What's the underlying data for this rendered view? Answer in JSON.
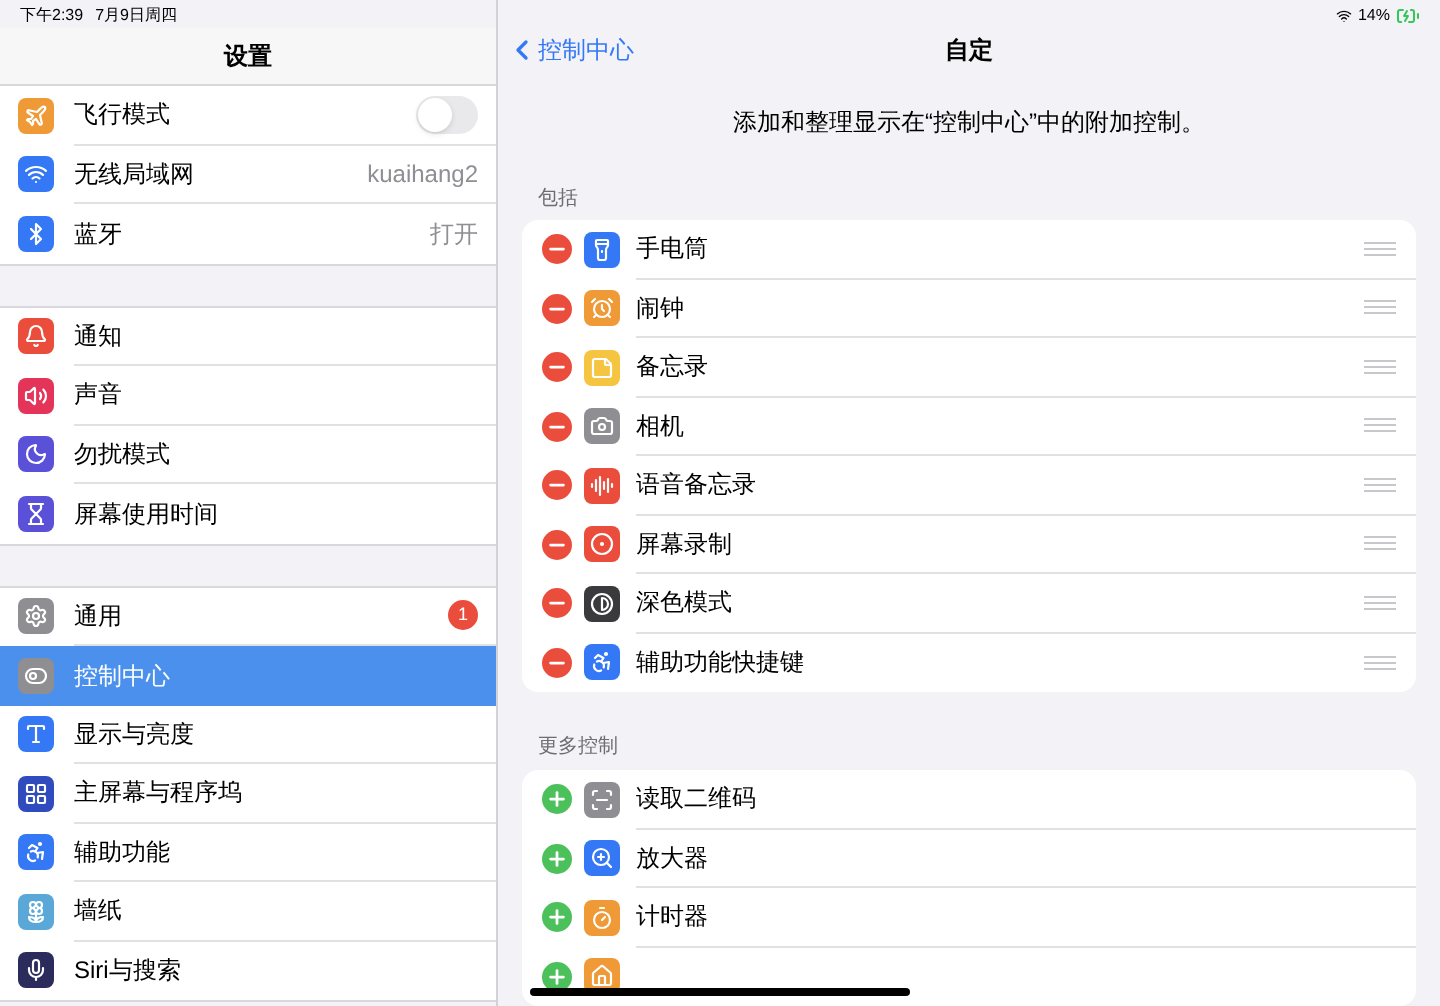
{
  "status_bar": {
    "time": "下午2:39",
    "date": "7月9日周四",
    "battery": "14%"
  },
  "sidebar": {
    "title": "设置",
    "groups": [
      [
        {
          "label": "飞行模式",
          "kind": "toggle",
          "on": false,
          "color": "#f09a37",
          "selected": false
        },
        {
          "label": "无线局域网",
          "kind": "value",
          "value": "kuaihang2",
          "color": "#3478f6",
          "selected": false
        },
        {
          "label": "蓝牙",
          "kind": "value",
          "value": "打开",
          "color": "#3478f6",
          "selected": false
        }
      ],
      [
        {
          "label": "通知",
          "kind": "plain",
          "color": "#eb4d3d",
          "selected": false
        },
        {
          "label": "声音",
          "kind": "plain",
          "color": "#e4345a",
          "selected": false
        },
        {
          "label": "勿扰模式",
          "kind": "plain",
          "color": "#5b51d8",
          "selected": false
        },
        {
          "label": "屏幕使用时间",
          "kind": "plain",
          "color": "#5b51d8",
          "selected": false
        }
      ],
      [
        {
          "label": "通用",
          "kind": "badge",
          "badge": "1",
          "color": "#8e8e93",
          "selected": false
        },
        {
          "label": "控制中心",
          "kind": "plain",
          "color": "#8e8e93",
          "selected": true
        },
        {
          "label": "显示与亮度",
          "kind": "plain",
          "color": "#3478f6",
          "selected": false
        },
        {
          "label": "主屏幕与程序坞",
          "kind": "plain",
          "color": "#2f4bbd",
          "selected": false
        },
        {
          "label": "辅助功能",
          "kind": "plain",
          "color": "#3478f6",
          "selected": false
        },
        {
          "label": "墙纸",
          "kind": "plain",
          "color": "#5aa8d8",
          "selected": false
        },
        {
          "label": "Siri与搜索",
          "kind": "plain",
          "color": "#2b2b5c",
          "selected": false
        }
      ]
    ]
  },
  "detail": {
    "back": "控制中心",
    "title": "自定",
    "description": "添加和整理显示在“控制中心”中的附加控制。",
    "included": {
      "header": "包括",
      "items": [
        {
          "label": "手电筒",
          "color": "#3478f6"
        },
        {
          "label": "闹钟",
          "color": "#f09a37"
        },
        {
          "label": "备忘录",
          "color": "#f5c542"
        },
        {
          "label": "相机",
          "color": "#8e8e93"
        },
        {
          "label": "语音备忘录",
          "color": "#eb4d3d"
        },
        {
          "label": "屏幕录制",
          "color": "#eb4d3d"
        },
        {
          "label": "深色模式",
          "color": "#3a3a3c"
        },
        {
          "label": "辅助功能快捷键",
          "color": "#3478f6"
        }
      ]
    },
    "more": {
      "header": "更多控制",
      "items": [
        {
          "label": "读取二维码",
          "color": "#8e8e93"
        },
        {
          "label": "放大器",
          "color": "#3478f6"
        },
        {
          "label": "计时器",
          "color": "#f09a37"
        },
        {
          "color": "#f09a37"
        }
      ]
    }
  }
}
